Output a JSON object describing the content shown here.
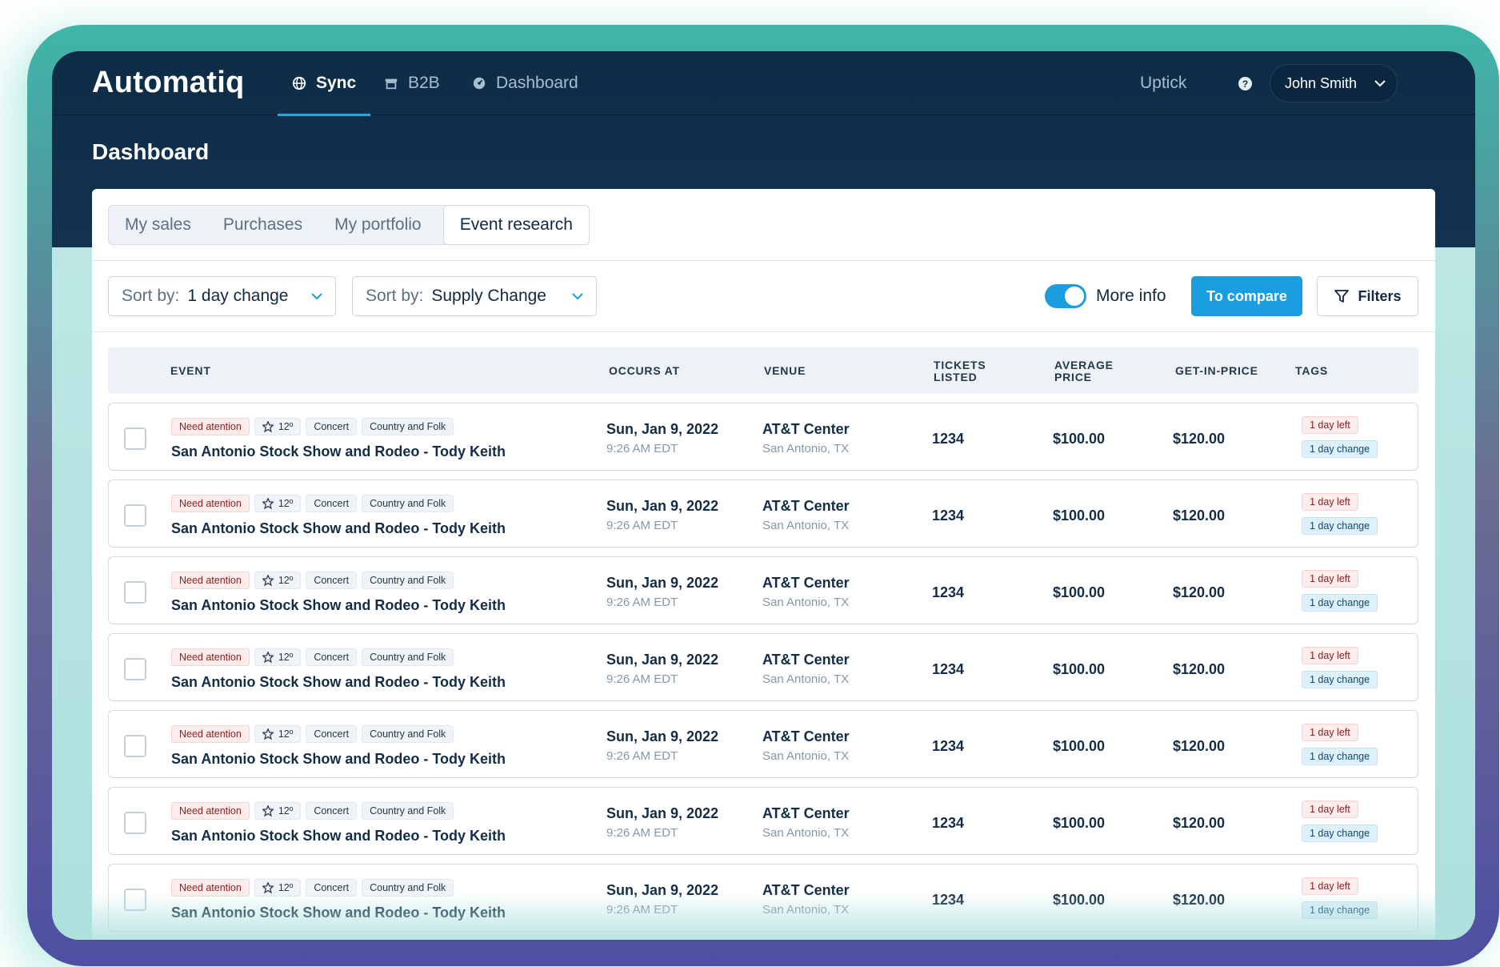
{
  "brand": {
    "name": "Automatiq"
  },
  "nav": {
    "items": [
      {
        "label": "Sync",
        "icon": "globe-icon",
        "active": true
      },
      {
        "label": "B2B",
        "icon": "store-icon",
        "active": false
      },
      {
        "label": "Dashboard",
        "icon": "dashboard-icon",
        "active": false
      }
    ],
    "uptick": "Uptick",
    "help_icon": "?",
    "user": "John Smith",
    "user_chevron": "⌄"
  },
  "page": {
    "title": "Dashboard"
  },
  "tabs": [
    "My sales",
    "Purchases",
    "My portfolio",
    "Event research"
  ],
  "toolbar": {
    "sort1_label": "Sort by:",
    "sort1_value": "1 day change",
    "sort2_label": "Sort by:",
    "sort2_value": "Supply Change",
    "chevron": "⌄",
    "more_info": "More info",
    "compare": "To compare",
    "filters": "Filters"
  },
  "table": {
    "headers": {
      "event": "EVENT",
      "occurs": "OCCURS AT",
      "venue": "VENUE",
      "tickets": "TICKETS LISTED",
      "avg": "AVERAGE PRICE",
      "gip": "GET-IN-PRICE",
      "tags": "TAGS"
    },
    "rows": [
      {
        "attention": "Need atention",
        "rating": "12º",
        "genre": "Concert",
        "category": "Country and Folk",
        "name": "San Antonio Stock Show and Rodeo - Tody Keith",
        "date": "Sun, Jan 9, 2022",
        "time": "9:26 AM EDT",
        "venue": "AT&T Center",
        "city": "San Antonio, TX",
        "tickets": "1234",
        "avg": "$100.00",
        "gip": "$120.00",
        "tag1": "1 day left",
        "tag2": "1 day change"
      },
      {
        "attention": "Need atention",
        "rating": "12º",
        "genre": "Concert",
        "category": "Country and Folk",
        "name": "San Antonio Stock Show and Rodeo - Tody Keith",
        "date": "Sun, Jan 9, 2022",
        "time": "9:26 AM EDT",
        "venue": "AT&T Center",
        "city": "San Antonio, TX",
        "tickets": "1234",
        "avg": "$100.00",
        "gip": "$120.00",
        "tag1": "1 day left",
        "tag2": "1 day change"
      },
      {
        "attention": "Need atention",
        "rating": "12º",
        "genre": "Concert",
        "category": "Country and Folk",
        "name": "San Antonio Stock Show and Rodeo - Tody Keith",
        "date": "Sun, Jan 9, 2022",
        "time": "9:26 AM EDT",
        "venue": "AT&T Center",
        "city": "San Antonio, TX",
        "tickets": "1234",
        "avg": "$100.00",
        "gip": "$120.00",
        "tag1": "1 day left",
        "tag2": "1 day change"
      },
      {
        "attention": "Need atention",
        "rating": "12º",
        "genre": "Concert",
        "category": "Country and Folk",
        "name": "San Antonio Stock Show and Rodeo - Tody Keith",
        "date": "Sun, Jan 9, 2022",
        "time": "9:26 AM EDT",
        "venue": "AT&T Center",
        "city": "San Antonio, TX",
        "tickets": "1234",
        "avg": "$100.00",
        "gip": "$120.00",
        "tag1": "1 day left",
        "tag2": "1 day change"
      },
      {
        "attention": "Need atention",
        "rating": "12º",
        "genre": "Concert",
        "category": "Country and Folk",
        "name": "San Antonio Stock Show and Rodeo - Tody Keith",
        "date": "Sun, Jan 9, 2022",
        "time": "9:26 AM EDT",
        "venue": "AT&T Center",
        "city": "San Antonio, TX",
        "tickets": "1234",
        "avg": "$100.00",
        "gip": "$120.00",
        "tag1": "1 day left",
        "tag2": "1 day change"
      },
      {
        "attention": "Need atention",
        "rating": "12º",
        "genre": "Concert",
        "category": "Country and Folk",
        "name": "San Antonio Stock Show and Rodeo - Tody Keith",
        "date": "Sun, Jan 9, 2022",
        "time": "9:26 AM EDT",
        "venue": "AT&T Center",
        "city": "San Antonio, TX",
        "tickets": "1234",
        "avg": "$100.00",
        "gip": "$120.00",
        "tag1": "1 day left",
        "tag2": "1 day change"
      },
      {
        "attention": "Need atention",
        "rating": "12º",
        "genre": "Concert",
        "category": "Country and Folk",
        "name": "San Antonio Stock Show and Rodeo - Tody Keith",
        "date": "Sun, Jan 9, 2022",
        "time": "9:26 AM EDT",
        "venue": "AT&T Center",
        "city": "San Antonio, TX",
        "tickets": "1234",
        "avg": "$100.00",
        "gip": "$120.00",
        "tag1": "1 day left",
        "tag2": "1 day change"
      }
    ]
  },
  "colors": {
    "navy": "#0d2c46",
    "accent_blue": "#1a9ee0",
    "attention_bg": "#fdeceb",
    "change_bg": "#def0fb",
    "frame_teal": "#3fb6a8",
    "frame_purple": "#4e4fa3"
  }
}
